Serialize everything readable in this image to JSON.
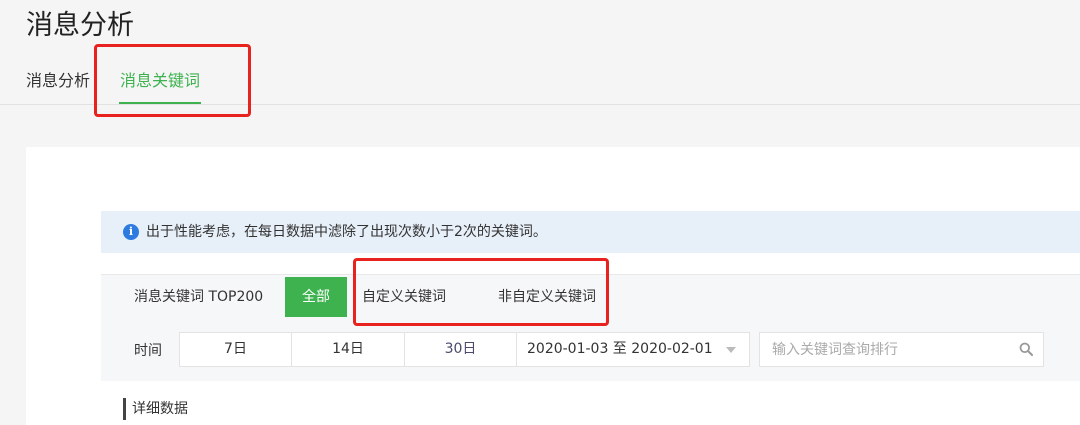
{
  "page": {
    "title": "消息分析"
  },
  "tabs": [
    {
      "label": "消息分析"
    },
    {
      "label": "消息关键词"
    }
  ],
  "notice": {
    "icon": "info-icon",
    "text": "出于性能考虑，在每日数据中滤除了出现次数小于2次的关键词。"
  },
  "filters": {
    "type_label": "消息关键词 TOP200",
    "types": [
      "全部",
      "自定义关键词",
      "非自定义关键词"
    ],
    "time_label": "时间",
    "periods": [
      "7日",
      "14日",
      "30日"
    ],
    "date_range": "2020-01-03 至 2020-02-01",
    "search_placeholder": "输入关键词查询排行"
  },
  "details": {
    "title": "详细数据"
  },
  "colors": {
    "accent": "#3eb24f",
    "notice_bg": "#e7eff9",
    "info_icon": "#2e7be0",
    "highlight": "#e8231f"
  }
}
